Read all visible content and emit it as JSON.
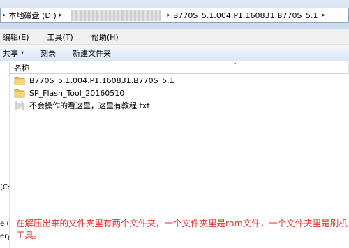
{
  "address": {
    "crumbs": [
      "本地磁盘 (D:)",
      "B770S_5.1.004.P1.160831.B770S_5.1"
    ],
    "sep": "▸"
  },
  "menu": {
    "edit": "编辑(E)",
    "tools": "工具(T)",
    "help": "帮助(H)"
  },
  "toolbar": {
    "share": "共享",
    "share_arrow": "▾",
    "burn": "刻录",
    "new_folder": "新建文件夹"
  },
  "list": {
    "header_name": "名称",
    "sort_arrow": "^",
    "items": [
      {
        "name": "B770S_5.1.004.P1.160831.B770S_5.1",
        "type": "folder"
      },
      {
        "name": "SP_Flash_Tool_20160510",
        "type": "folder"
      },
      {
        "name": "不会操作的看这里，这里有教程.txt",
        "type": "text-file"
      }
    ]
  },
  "navpane": {
    "drive_fragment": "(C:",
    "fragment2": "e (I",
    "fragment3": "ery"
  },
  "annotation": {
    "text": "在解压出来的文件夹里有两个文件夹，一个文件夹里是rom文件，一个文件夹里是刷机工具。"
  },
  "colors": {
    "folder": "#e8c14a",
    "annotation": "#e8322a"
  }
}
